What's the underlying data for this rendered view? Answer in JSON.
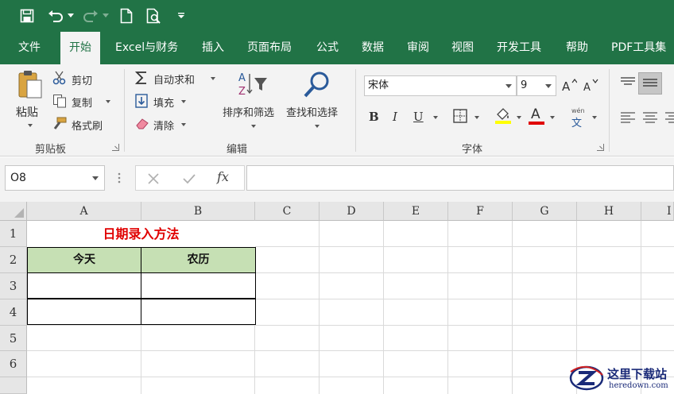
{
  "qat": {
    "items": [
      "save",
      "undo",
      "redo",
      "new",
      "print-preview",
      "customize"
    ]
  },
  "tabs": [
    "文件",
    "开始",
    "Excel与财务",
    "插入",
    "页面布局",
    "公式",
    "数据",
    "审阅",
    "视图",
    "开发工具",
    "帮助",
    "PDF工具集"
  ],
  "active_tab": "开始",
  "ribbon": {
    "clipboard": {
      "paste": "粘贴",
      "cut": "剪切",
      "copy": "复制",
      "format_painter": "格式刷",
      "group_label": "剪贴板"
    },
    "editing": {
      "autosum": "自动求和",
      "fill": "填充",
      "clear": "清除",
      "sort_filter": "排序和筛选",
      "find_select": "查找和选择",
      "group_label": "编辑"
    },
    "font": {
      "font_name": "宋体",
      "font_size": "9",
      "bold": "B",
      "italic": "I",
      "underline": "U",
      "font_color_letter": "A",
      "phonetic_top": "wén",
      "phonetic_bottom": "文",
      "group_label": "字体"
    }
  },
  "formula_bar": {
    "name_box": "O8",
    "fx": "fx",
    "value": ""
  },
  "sheet": {
    "columns": [
      "A",
      "B",
      "C",
      "D",
      "E",
      "F",
      "G",
      "H",
      "I"
    ],
    "rows": [
      "1",
      "2",
      "3",
      "4",
      "5",
      "6"
    ],
    "title": "日期录入方法",
    "header_a": "今天",
    "header_b": "农历"
  },
  "watermark": {
    "name": "这里下载站",
    "url": "heredown.com"
  },
  "colors": {
    "excel_green": "#217346",
    "header_fill": "#c6e0b4",
    "title_red": "#e00000"
  }
}
